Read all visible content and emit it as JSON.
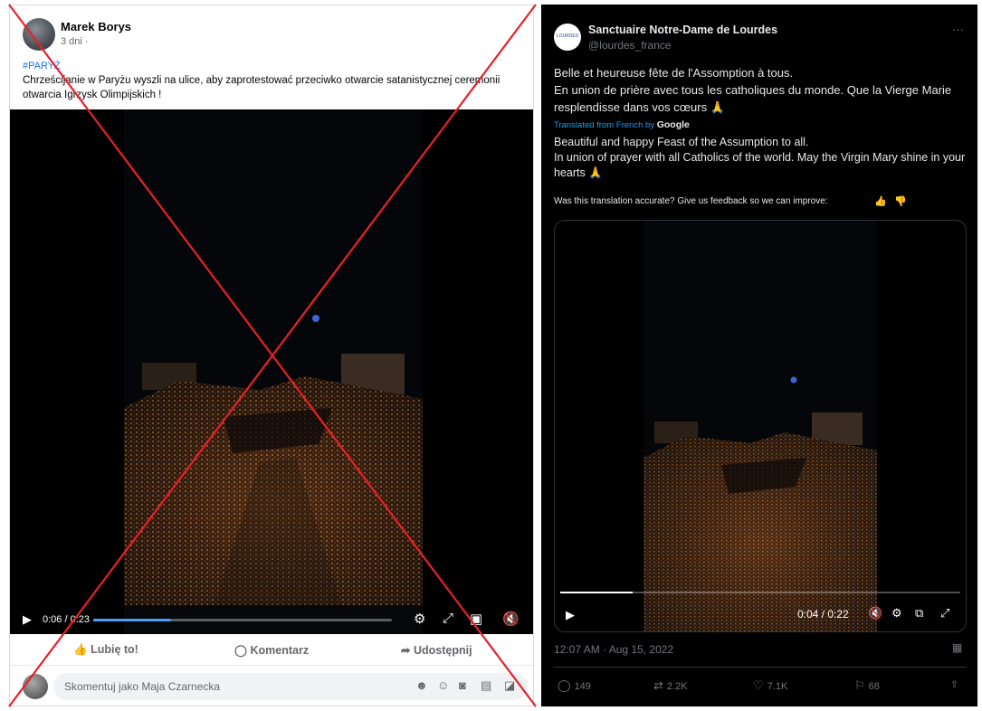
{
  "facebook_post": {
    "author": "Marek Borys",
    "time": "3 dni ·",
    "hashtag": "#PARYŻ",
    "text": "Chrześcijanie w Paryżu wyszli na ulice, aby zaprotestować przeciwko otwarcie satanistycznej ceremonii otwarcia Igrzysk Olimpijskich !",
    "video": {
      "timecode": "0:06 / 0:23",
      "progress": 0.26,
      "icons": [
        "play-icon",
        "gear-icon",
        "expand-icon",
        "pip-icon",
        "mute-icon"
      ]
    },
    "actions": {
      "like": "Lubię to!",
      "comment": "Komentarz",
      "share": "Udostępnij"
    },
    "comment_placeholder": "Skomentuj jako Maja Czarnecka",
    "colors": {
      "link": "#216fdb",
      "cross": "#e8202a"
    }
  },
  "tweet": {
    "avatar_text": "LOURDES",
    "display_name": "Sanctuaire Notre-Dame de Lourdes",
    "handle": "@lourdes_france",
    "more": "···",
    "text_line1": "Belle et heureuse fête de l'Assomption à tous.",
    "text_line2": "En union de prière avec tous les catholiques du monde. Que la Vierge Marie resplendisse dans vos cœurs 🙏",
    "translated_prefix": "Translated from French by",
    "translated_brand": "Google",
    "translation_line1": "Beautiful and happy Feast of the Assumption to all.",
    "translation_line2": "In union of prayer with all Catholics of the world. May the Virgin Mary shine in your hearts 🙏",
    "feedback_prompt": "Was this translation accurate? Give us feedback so we can improve:",
    "video": {
      "timecode": "0:04 / 0:22",
      "progress": 0.18
    },
    "timestamp": "12:07 AM · Aug 15, 2022",
    "stats": {
      "replies": "149",
      "reposts": "2.2K",
      "likes": "7.1K",
      "bookmarks": "68"
    },
    "colors": {
      "background": "#000000",
      "accent": "#1d9bf0",
      "muted": "#71767b"
    }
  }
}
